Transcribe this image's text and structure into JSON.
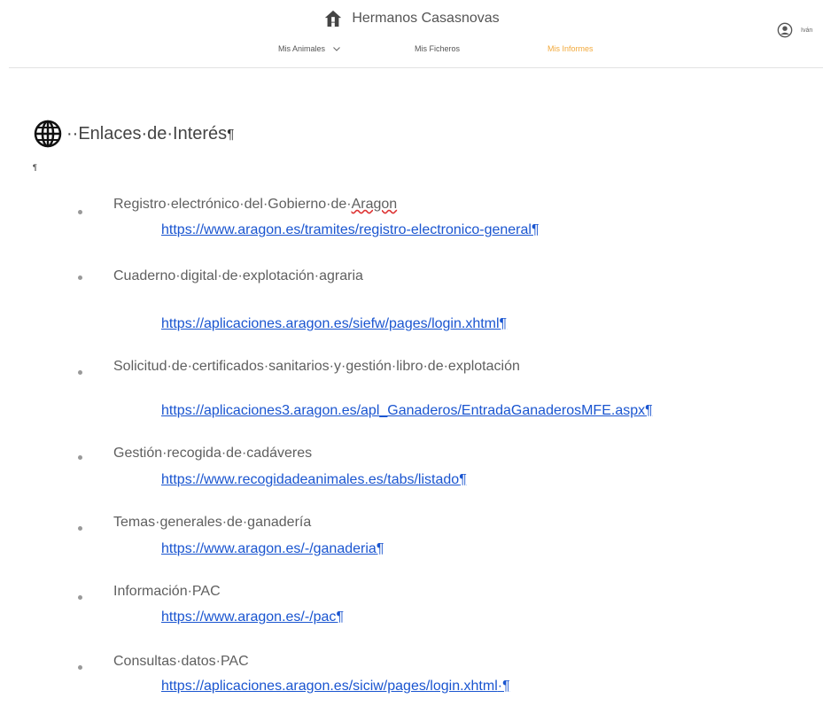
{
  "header": {
    "app_title": "Hermanos Casasnovas",
    "nav": [
      {
        "label": "Mis Animales",
        "active": false,
        "has_dropdown": true
      },
      {
        "label": "Mis Ficheros",
        "active": false,
        "has_dropdown": false
      },
      {
        "label": "Mis Informes",
        "active": true,
        "has_dropdown": false
      }
    ],
    "user_name": "Iván",
    "active_color": "#f2a93b"
  },
  "document": {
    "title": "··Enlaces·de·Interés",
    "pilcrow": "¶",
    "empty_para_mark": "¶",
    "links": [
      {
        "label": "Registro·electrónico·del·Gobierno·de·",
        "label_misspelled": "Aragon",
        "url": "https://www.aragon.es/tramites/registro-electronico-general",
        "mark": "¶"
      },
      {
        "label": "Cuaderno·digital·de·explotación·agraria",
        "url": "https://aplicaciones.aragon.es/siefw/pages/login.xhtml",
        "mark": "¶"
      },
      {
        "label": "Solicitud·de·certificados·sanitarios·y·gestión·libro·de·explotación",
        "url": "https://aplicaciones3.aragon.es/apl_Ganaderos/EntradaGanaderosMFE.aspx",
        "mark": "¶"
      },
      {
        "label": "Gestión·recogida·de·cadáveres",
        "url": "https://www.recogidadeanimales.es/tabs/listado",
        "mark": "¶"
      },
      {
        "label": "Temas·generales·de·ganadería",
        "url": "https://www.aragon.es/-/ganaderia",
        "mark": "¶"
      },
      {
        "label": "Información·PAC",
        "url": "https://www.aragon.es/-/pac",
        "mark": "¶"
      },
      {
        "label": "Consultas·datos·PAC",
        "url": "https://aplicaciones.aragon.es/siciw/pages/login.xhtml",
        "mark": "·¶"
      }
    ],
    "link_color": "#1a55d0"
  }
}
